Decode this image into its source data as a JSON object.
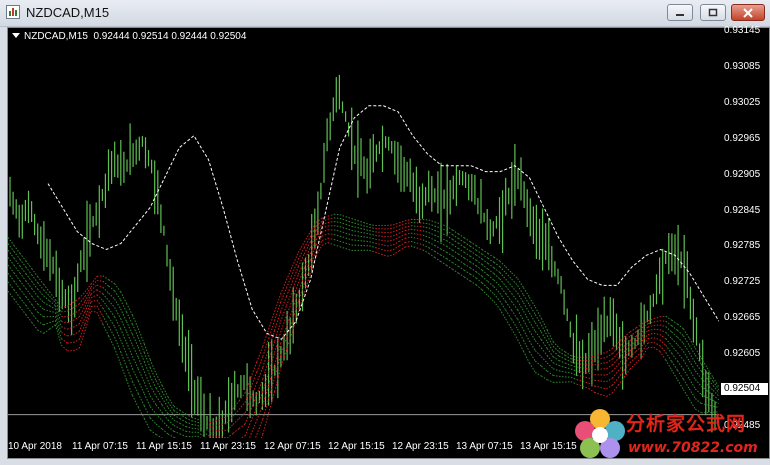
{
  "window": {
    "title": "NZDCAD,M15",
    "buttons": [
      "minimize",
      "maximize",
      "close"
    ]
  },
  "chart": {
    "symbol_info": "NZDCAD,M15",
    "ohlc_text": "0.92444 0.92514 0.92444 0.92504",
    "current_price": "0.92504",
    "colors": {
      "background": "#000000",
      "candles": "#5fbf52",
      "envelope_upper": "#ffffff",
      "ribbon_up": "#cc2020",
      "ribbon_down": "#2e8b2e",
      "price_line": "#9a9a9a"
    }
  },
  "chart_data": {
    "type": "line",
    "price_ticks": [
      "0.93145",
      "0.93085",
      "0.93025",
      "0.92965",
      "0.92905",
      "0.92845",
      "0.92785",
      "0.92725",
      "0.92665",
      "0.92605",
      "0.92545",
      "0.92485"
    ],
    "time_ticks": [
      "10 Apr 2018",
      "11 Apr 07:15",
      "11 Apr 15:15",
      "11 Apr 23:15",
      "12 Apr 07:15",
      "12 Apr 15:15",
      "12 Apr 23:15",
      "13 Apr 07:15",
      "13 Apr 15:15"
    ],
    "ylim": [
      0.92465,
      0.9315
    ],
    "close": [
      0.9287,
      0.9283,
      0.9285,
      0.9279,
      0.9276,
      0.9271,
      0.9268,
      0.9276,
      0.9282,
      0.9287,
      0.9293,
      0.9291,
      0.9294,
      0.9296,
      0.9291,
      0.9282,
      0.927,
      0.9262,
      0.9255,
      0.925,
      0.9247,
      0.925,
      0.9254,
      0.9256,
      0.9252,
      0.9255,
      0.9258,
      0.9262,
      0.9268,
      0.9274,
      0.9282,
      0.9296,
      0.9305,
      0.9299,
      0.9293,
      0.929,
      0.9295,
      0.9296,
      0.9293,
      0.929,
      0.9286,
      0.9288,
      0.9286,
      0.9287,
      0.929,
      0.9289,
      0.9285,
      0.9281,
      0.9283,
      0.9288,
      0.929,
      0.9283,
      0.928,
      0.9276,
      0.9272,
      0.9263,
      0.9258,
      0.9261,
      0.9264,
      0.9267,
      0.926,
      0.9262,
      0.9265,
      0.927,
      0.9276,
      0.9278,
      0.9275,
      0.9266,
      0.9256,
      0.925
    ],
    "envelope_upper": [
      0.9289,
      0.9285,
      0.9281,
      0.9279,
      0.9278,
      0.9279,
      0.9282,
      0.9285,
      0.929,
      0.9295,
      0.9297,
      0.9293,
      0.9285,
      0.9276,
      0.9268,
      0.9264,
      0.9263,
      0.9266,
      0.9273,
      0.9284,
      0.9295,
      0.93,
      0.9302,
      0.9302,
      0.9301,
      0.9297,
      0.9294,
      0.9292,
      0.9292,
      0.9292,
      0.9291,
      0.9291,
      0.9292,
      0.929,
      0.9285,
      0.928,
      0.9276,
      0.9273,
      0.9272,
      0.9272,
      0.9275,
      0.9277,
      0.9278,
      0.9277,
      0.9274,
      0.927,
      0.9266
    ],
    "ribbon": [
      0.928,
      0.9276,
      0.9272,
      0.9268,
      0.927,
      0.9274,
      0.9272,
      0.9266,
      0.9258,
      0.9252,
      0.925,
      0.9249,
      0.925,
      0.9254,
      0.9262,
      0.9271,
      0.9278,
      0.9283,
      0.9284,
      0.9283,
      0.9282,
      0.9282,
      0.9283,
      0.9283,
      0.9282,
      0.928,
      0.9278,
      0.9276,
      0.9273,
      0.9268,
      0.9262,
      0.926,
      0.926,
      0.9261,
      0.9264,
      0.9266,
      0.9267,
      0.9265,
      0.926,
      0.9255
    ]
  },
  "watermark": {
    "line1": "分析家公式网",
    "line2": "www.70822.com"
  }
}
